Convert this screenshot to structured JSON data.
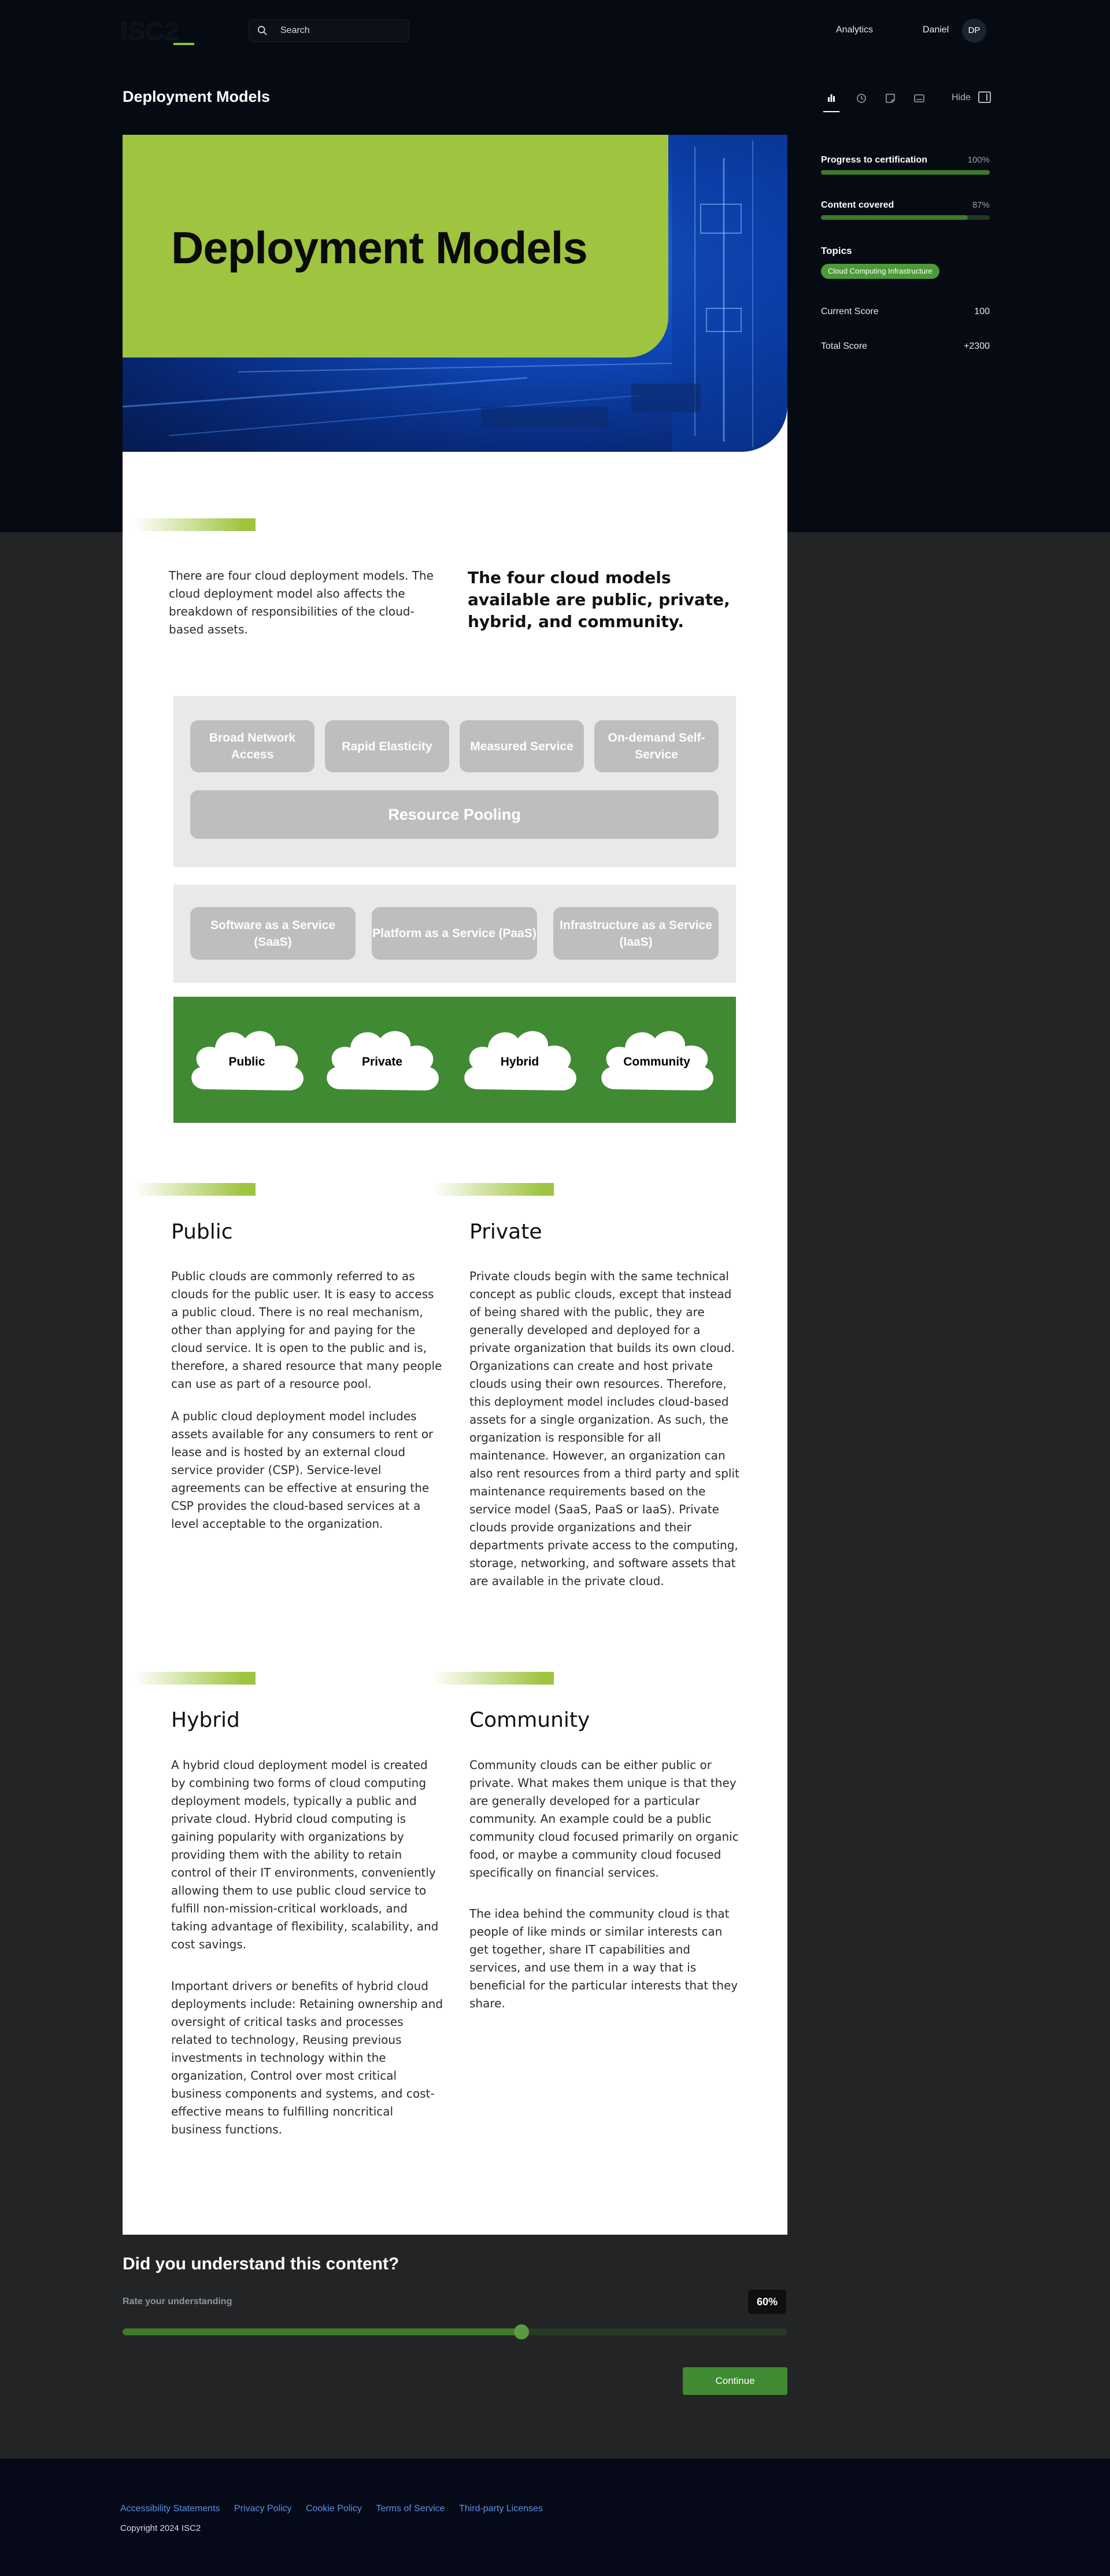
{
  "header": {
    "logo_text": "ISC2",
    "search_placeholder": "Search",
    "nav_analytics": "Analytics",
    "user_name": "Daniel",
    "user_initials": "DP"
  },
  "page": {
    "title": "Deployment Models",
    "hide_label": "Hide"
  },
  "sidebar": {
    "progress_label": "Progress to certification",
    "progress_value": "100%",
    "progress_fraction": 1.0,
    "content_label": "Content covered",
    "content_value": "87%",
    "content_fraction": 0.87,
    "topics_title": "Topics",
    "topic": "Cloud Computing Infrastructure",
    "current_score_label": "Current Score",
    "current_score_value": "100",
    "total_score_label": "Total Score",
    "total_score_value": "+2300"
  },
  "hero": {
    "title": "Deployment Models"
  },
  "intro": {
    "text": "There are four cloud deployment models. The cloud deployment model also affects the breakdown of responsibilities of the cloud-based assets.",
    "lead": "The four cloud models available are public, private, hybrid, and community."
  },
  "diagram": {
    "characteristics": [
      "Broad Network Access",
      "Rapid Elasticity",
      "Measured Service",
      "On-demand Self-Service"
    ],
    "pooling": "Resource Pooling",
    "services": [
      "Software as a Service (SaaS)",
      "Platform as a Service (PaaS)",
      "Infrastructure as a Service (IaaS)"
    ],
    "models": [
      "Public",
      "Private",
      "Hybrid",
      "Community"
    ]
  },
  "sections": {
    "public": {
      "title": "Public",
      "p1": "Public clouds are commonly referred to as clouds for the public user. It is easy to access a public cloud. There is no real mechanism, other than applying for and paying for the cloud service. It is open to the public and is, therefore, a shared resource that many people can use as part of a resource pool.",
      "p2": "A public cloud deployment model includes assets available for any consumers to rent or lease and is hosted by an external cloud service provider (CSP). Service-level agreements can be effective at ensuring the CSP provides the cloud-based services at a level acceptable to the organization."
    },
    "private": {
      "title": "Private",
      "p1": "Private clouds begin with the same technical concept as public clouds, except that instead of being shared with the public, they are generally developed and deployed for a private organization that builds its own cloud. Organizations can create and host private clouds using their own resources. Therefore, this deployment model includes cloud-based assets for a single organization. As such, the organization is responsible for all maintenance. However, an organization can also rent resources from a third party and split maintenance requirements based on the service model (SaaS, PaaS or IaaS). Private clouds provide organizations and their departments private access to the computing, storage, networking, and software assets that are available in the private cloud."
    },
    "hybrid": {
      "title": "Hybrid",
      "p1": "A hybrid cloud deployment model is created by combining two forms of cloud computing deployment models, typically a public and private cloud. Hybrid cloud computing is gaining popularity with organizations by providing them with the ability to retain control of their IT environments, conveniently allowing them to use public cloud service to fulfill non-mission-critical workloads, and taking advantage of flexibility, scalability, and cost savings.",
      "p2": "Important drivers or benefits of hybrid cloud deployments include: Retaining ownership and oversight of critical tasks and processes related to technology, Reusing previous investments in technology within the organization, Control over most critical business components and systems, and cost-effective means to fulfilling noncritical business functions."
    },
    "community": {
      "title": "Community",
      "p1": "Community clouds can be either public or private. What makes them unique is that they are generally developed for a particular community. An example could be a public community cloud focused primarily on organic food, or maybe a community cloud focused specifically on financial services.",
      "p2": "The idea behind the community cloud is that people of like minds or similar interests can get together, share IT capabilities and services, and use them in a way that is beneficial for the particular interests that they share."
    }
  },
  "feedback": {
    "title": "Did you understand this content?",
    "rate_label": "Rate your understanding",
    "value": "60",
    "unit": "%",
    "fraction": 0.6,
    "continue_label": "Continue"
  },
  "footer": {
    "links": [
      "Accessibility Statements",
      "Privacy Policy",
      "Cookie Policy",
      "Terms of Service",
      "Third-party Licenses"
    ],
    "copyright": "Copyright 2024 ISC2"
  },
  "colors": {
    "accent_green": "#9fc43f",
    "brand_green": "#3f8a33",
    "background_dark": "#060a13",
    "link_blue": "#5d8fe0"
  }
}
